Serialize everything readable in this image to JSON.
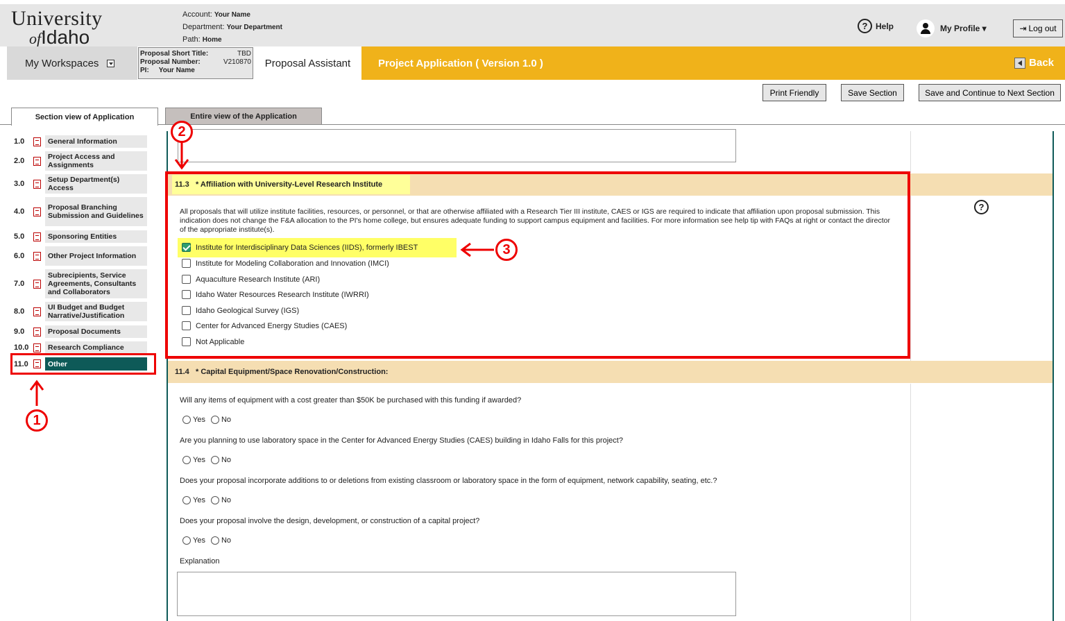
{
  "header": {
    "logo": {
      "line1": "University",
      "line2_of": "of",
      "line2_name": "Idaho"
    },
    "account_label": "Account:",
    "account_value": "Your Name",
    "department_label": "Department:",
    "department_value": "Your Department",
    "path_label": "Path:",
    "path_value": "Home",
    "help_label": "Help",
    "profile_label": "My Profile ▾",
    "logout_label": "Log out"
  },
  "nav": {
    "workspaces_label": "My Workspaces",
    "proposal_short_title_label": "Proposal Short Title:",
    "proposal_short_title_value": "TBD",
    "proposal_number_label": "Proposal Number:",
    "proposal_number_value": "V210870",
    "pi_label": "PI:",
    "pi_value": "Your Name",
    "assistant_label": "Proposal Assistant",
    "project_title": "Project Application ( Version 1.0 )",
    "back_label": "Back"
  },
  "toolbar": {
    "print_label": "Print Friendly",
    "save_label": "Save Section",
    "save_continue_label": "Save and Continue to Next Section"
  },
  "tabs": {
    "section_view": "Section view of Application",
    "entire_view": "Entire view of the Application"
  },
  "sidebar": {
    "items": [
      {
        "num": "1.0",
        "label": "General Information"
      },
      {
        "num": "2.0",
        "label": "Project Access and Assignments"
      },
      {
        "num": "3.0",
        "label": "Setup Department(s) Access"
      },
      {
        "num": "4.0",
        "label": "Proposal Branching Submission and Guidelines"
      },
      {
        "num": "5.0",
        "label": "Sponsoring Entities"
      },
      {
        "num": "6.0",
        "label": "Other Project Information"
      },
      {
        "num": "7.0",
        "label": "Subrecipients, Service Agreements, Consultants and Collaborators"
      },
      {
        "num": "8.0",
        "label": "UI Budget and Budget Narrative/Justification"
      },
      {
        "num": "9.0",
        "label": "Proposal Documents"
      },
      {
        "num": "10.0",
        "label": "Research Compliance"
      },
      {
        "num": "11.0",
        "label": "Other"
      }
    ]
  },
  "section113": {
    "number": "11.3",
    "title": "* Affiliation with University-Level Research Institute",
    "description": "All proposals that will utilize institute facilities, resources, or personnel, or that are otherwise affiliated with a Research Tier III institute, CAES or IGS are required to indicate that affiliation upon proposal submission. This indication does not change the F&A allocation to the PI's home college, but ensures adequate funding to support campus equipment and facilities. For more information see help tip with FAQs at right or contact the director of the appropriate institute(s).",
    "options": [
      "Institute for Interdisciplinary Data Sciences (IIDS), formerly IBEST",
      "Institute for Modeling Collaboration and Innovation (IMCI)",
      "Aquaculture Research Institute (ARI)",
      "Idaho Water Resources Research Institute (IWRRI)",
      "Idaho Geological Survey (IGS)",
      "Center for Advanced Energy Studies (CAES)",
      "Not Applicable"
    ],
    "checked_index": 0
  },
  "section114": {
    "number": "11.4",
    "title": "* Capital Equipment/Space Renovation/Construction:",
    "questions": [
      "Will any items of equipment with a cost greater than $50K be purchased with this funding if awarded?",
      "Are you planning to use laboratory space in the Center for Advanced Energy Studies (CAES) building in Idaho Falls for this project?",
      "Does your proposal incorporate additions to or deletions from existing classroom or laboratory space in the form of equipment, network capability, seating, etc.?",
      "Does your proposal involve the design, development, or construction of a capital project?"
    ],
    "yes_label": "Yes",
    "no_label": "No",
    "explanation_label": "Explanation"
  },
  "annotations": {
    "m1": "1",
    "m2": "2",
    "m3": "3",
    "color": "#e00000"
  }
}
